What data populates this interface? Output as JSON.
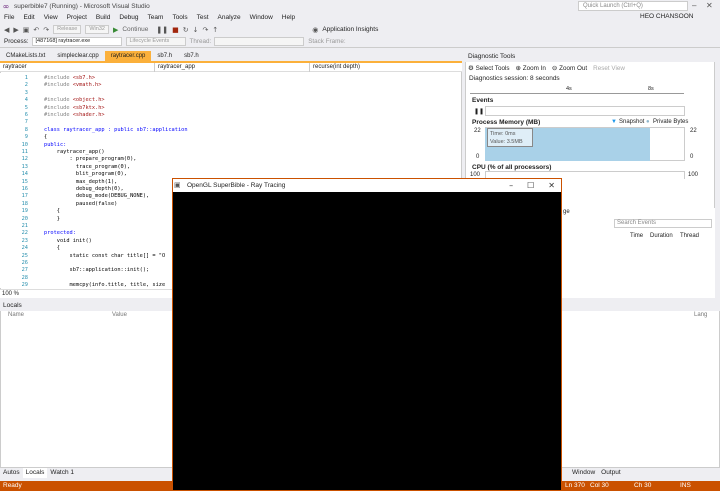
{
  "window": {
    "title": "superbible7 (Running) - Microsoft Visual Studio",
    "quick_launch": "Quick Launch (Ctrl+Q)",
    "user": "HEO CHANSOON"
  },
  "menu": [
    "File",
    "Edit",
    "View",
    "Project",
    "Build",
    "Debug",
    "Team",
    "Tools",
    "Test",
    "Analyze",
    "Window",
    "Help"
  ],
  "toolbar": {
    "config": "Release",
    "platform": "Win32",
    "continue": "Continue",
    "app_insights": "Application Insights"
  },
  "procbar": {
    "process_label": "Process:",
    "process": "[487168] raytracer.exe",
    "lifecycle": "Lifecycle Events",
    "thread": "Thread:",
    "stack": "Stack Frame:"
  },
  "tabs": [
    "CMakeLists.txt",
    "simpleclear.cpp",
    "raytracer.cpp",
    "sb7.h",
    "sb7.h"
  ],
  "navbar": {
    "project": "raytracer",
    "scope": "raytracer_app",
    "member": "recurse(int depth)"
  },
  "code": {
    "lines": [
      {
        "n": "1",
        "t": "#include <sb7.h>"
      },
      {
        "n": "2",
        "t": "#include <vmath.h>"
      },
      {
        "n": "3",
        "t": ""
      },
      {
        "n": "4",
        "t": "#include <object.h>"
      },
      {
        "n": "5",
        "t": "#include <sb7ktx.h>"
      },
      {
        "n": "6",
        "t": "#include <shader.h>"
      },
      {
        "n": "7",
        "t": ""
      },
      {
        "n": "8",
        "t": "class raytracer_app : public sb7::application"
      },
      {
        "n": "9",
        "t": "{"
      },
      {
        "n": "10",
        "t": "public:"
      },
      {
        "n": "11",
        "t": "    raytracer_app()"
      },
      {
        "n": "12",
        "t": "        : prepare_program(0),"
      },
      {
        "n": "13",
        "t": "          trace_program(0),"
      },
      {
        "n": "14",
        "t": "          blit_program(0),"
      },
      {
        "n": "15",
        "t": "          max_depth(1),"
      },
      {
        "n": "16",
        "t": "          debug_depth(0),"
      },
      {
        "n": "17",
        "t": "          debug_mode(DEBUG_NONE),"
      },
      {
        "n": "18",
        "t": "          paused(false)"
      },
      {
        "n": "19",
        "t": "    {"
      },
      {
        "n": "20",
        "t": "    }"
      },
      {
        "n": "21",
        "t": ""
      },
      {
        "n": "22",
        "t": "protected:"
      },
      {
        "n": "23",
        "t": "    void init()"
      },
      {
        "n": "24",
        "t": "    {"
      },
      {
        "n": "25",
        "t": "        static const char title[] = \"O"
      },
      {
        "n": "26",
        "t": ""
      },
      {
        "n": "27",
        "t": "        sb7::application::init();"
      },
      {
        "n": "28",
        "t": ""
      },
      {
        "n": "29",
        "t": "        memcpy(info.title, title, size"
      }
    ]
  },
  "zoom": "100 %",
  "locals": {
    "title": "Locals",
    "col_name": "Name",
    "col_value": "Value",
    "col_type": "Lang"
  },
  "bottom_tabs": [
    "Autos",
    "Locals",
    "Watch 1"
  ],
  "bottom_tabs_right": [
    "Window",
    "Output"
  ],
  "status": {
    "left": "Ready",
    "ln": "Ln 370",
    "col": "Col 30",
    "ch": "Ch 30",
    "mode": "INS"
  },
  "diag": {
    "title": "Diagnostic Tools",
    "select_tools": "Select Tools",
    "zoom_in": "Zoom In",
    "zoom_out": "Zoom Out",
    "reset_view": "Reset View",
    "session": "Diagnostics session: 8 seconds",
    "tick1": "4s",
    "tick2": "8s",
    "events": "Events",
    "memory": "Process Memory (MB)",
    "snapshot": "Snapshot",
    "private_bytes": "Private Bytes",
    "mem_max": "22",
    "mem_min": "0",
    "tooltip_time": "Time: 0ms",
    "tooltip_value": "Value: 3.5MB",
    "cpu": "CPU (% of all processors)",
    "cpu_max": "100",
    "search": "Search Events",
    "col_time": "Time",
    "col_duration": "Duration",
    "col_thread": "Thread",
    "ge_label": "ge"
  },
  "gl": {
    "title": "OpenGL SuperBible - Ray Tracing"
  }
}
